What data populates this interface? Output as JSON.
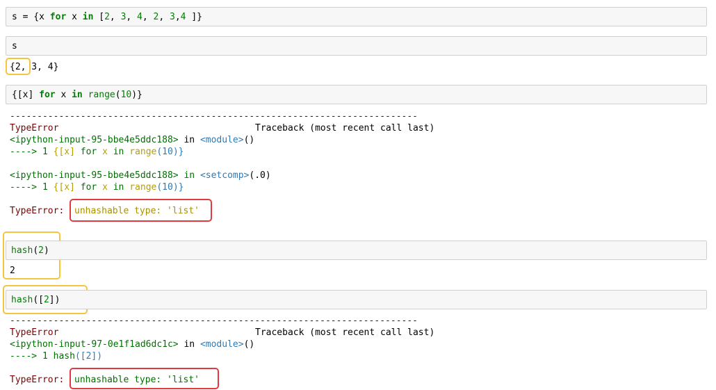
{
  "cells": [
    {
      "input_tokens": [
        "s = {x ",
        "for",
        " x ",
        "in",
        " [",
        "2",
        ", ",
        "3",
        ", ",
        "4",
        ", ",
        "2",
        ", ",
        "3",
        ",",
        "4",
        " ]}"
      ],
      "output": ""
    },
    {
      "input": "s",
      "output": "{2, 3, 4}"
    },
    {
      "input_tokens": [
        "{[x] ",
        "for",
        " x ",
        "in",
        " ",
        "range",
        "(",
        "10",
        ")}"
      ]
    }
  ],
  "error1": {
    "dashes": "---------------------------------------------------------------------------",
    "type": "TypeError",
    "traceback_label": "Traceback (most recent call last)",
    "frame1_file": "<ipython-input-95-bbe4e5ddc188>",
    "frame1_in": " in ",
    "frame1_ctx": "<module>",
    "frame1_paren": "()",
    "frame1_arrow": "----> 1 ",
    "frame1_code_a": "{[x]",
    "frame1_code_b": " for ",
    "frame1_code_c": "x",
    "frame1_code_d": " in ",
    "frame1_code_e": "range",
    "frame1_code_f": "(10)}",
    "frame2_file": "<ipython-input-95-bbe4e5ddc188>",
    "frame2_in": " in ",
    "frame2_ctx": "<setcomp>",
    "frame2_paren": "(.0)",
    "frame2_arrow": "----> 1 ",
    "msg_label": "TypeError:",
    "msg": "unhashable type: 'list'"
  },
  "cell4": {
    "fn": "hash",
    "open": "(",
    "arg": "2",
    "close": ")",
    "output": "2"
  },
  "cell5": {
    "fn": "hash",
    "open": "([",
    "arg": "2",
    "close": "])"
  },
  "error2": {
    "dashes": "---------------------------------------------------------------------------",
    "type": "TypeError",
    "traceback_label": "Traceback (most recent call last)",
    "frame1_file": "<ipython-input-97-0e1f1ad6dc1c>",
    "frame1_in": " in ",
    "frame1_ctx": "<module>",
    "frame1_paren": "()",
    "frame1_arrow": "----> 1 ",
    "frame1_code_a": "hash",
    "frame1_code_b": "([2])",
    "msg_label": "TypeError:",
    "msg": "unhashable type: 'list'"
  },
  "colors": {
    "highlight_yellow": "#f5c542",
    "highlight_red": "#e0393e"
  }
}
